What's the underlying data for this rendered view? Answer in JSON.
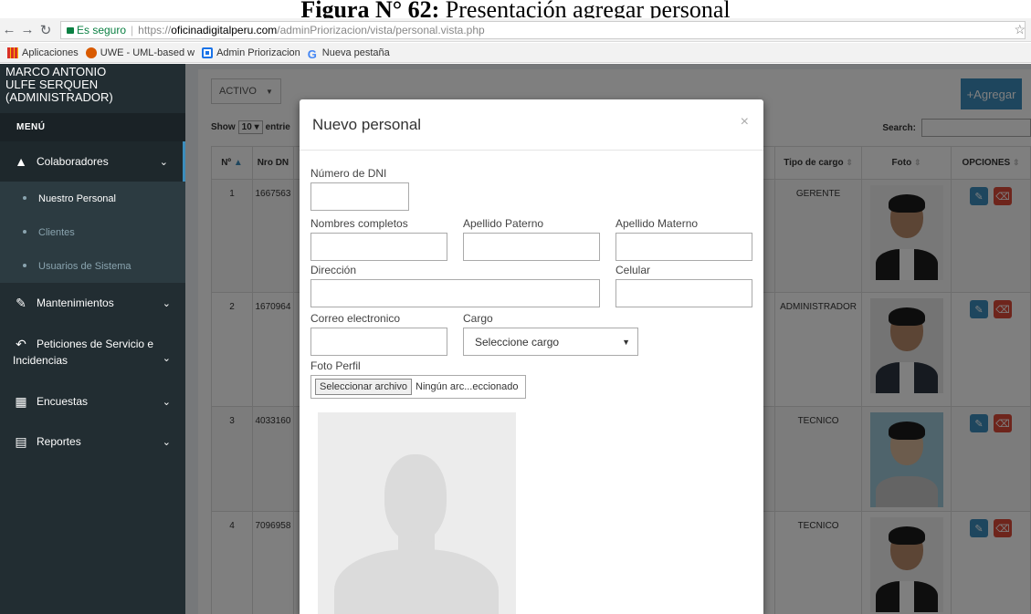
{
  "caption": {
    "bold": "Figura N° 62:",
    "text": "Presentación agregar personal"
  },
  "browser": {
    "secure_label": "Es seguro",
    "url_scheme": "https://",
    "url_host": "oficinadigitalperu.com",
    "url_path": "/adminPriorizacion/vista/personal.vista.php",
    "bookmarks": [
      {
        "label": "Aplicaciones",
        "icon": "apps-icon"
      },
      {
        "label": "UWE - UML-based w",
        "icon": "uwe-icon"
      },
      {
        "label": "Admin Priorizacion",
        "icon": "admin-icon"
      },
      {
        "label": "Nueva pestaña",
        "icon": "google-icon"
      }
    ]
  },
  "sidebar": {
    "user_line1": "MARCO ANTONIO",
    "user_line2": "ULFE SERQUEN",
    "user_line3": "(ADMINISTRADOR)",
    "menu_header": "MENÚ",
    "colaboradores": "Colaboradores",
    "sub_items": [
      "Nuestro Personal",
      "Clientes",
      "Usuarios de Sistema"
    ],
    "mantenimientos": "Mantenimientos",
    "peticiones_line1": "Peticiones de Servicio e",
    "peticiones_line2": "Incidencias",
    "encuestas": "Encuestas",
    "reportes": "Reportes"
  },
  "toolbar": {
    "status_select": "ACTIVO",
    "add_button": "Agregar",
    "show_label": "Show",
    "show_value": "10",
    "entries_label": "entrie",
    "search_label": "Search:"
  },
  "table": {
    "headers": [
      "Nº",
      "Nro DN",
      "Tipo de cargo",
      "Foto",
      "OPCIONES"
    ],
    "rows": [
      {
        "num": "1",
        "dni": "1667563",
        "cargo": "GERENTE"
      },
      {
        "num": "2",
        "dni": "1670964",
        "cargo": "ADMINISTRADOR"
      },
      {
        "num": "3",
        "dni": "4033160",
        "cargo": "TECNICO"
      },
      {
        "num": "4",
        "dni": "7096958",
        "cargo": "TECNICO"
      }
    ]
  },
  "modal": {
    "title": "Nuevo personal",
    "close": "×",
    "dni_label": "Número de DNI",
    "nombres_label": "Nombres completos",
    "paterno_label": "Apellido Paterno",
    "materno_label": "Apellido Materno",
    "direccion_label": "Dirección",
    "celular_label": "Celular",
    "correo_label": "Correo electronico",
    "cargo_label": "Cargo",
    "cargo_value": "Seleccione cargo",
    "foto_label": "Foto Perfil",
    "file_button": "Seleccionar archivo",
    "file_status": "Ningún arc...eccionado"
  }
}
